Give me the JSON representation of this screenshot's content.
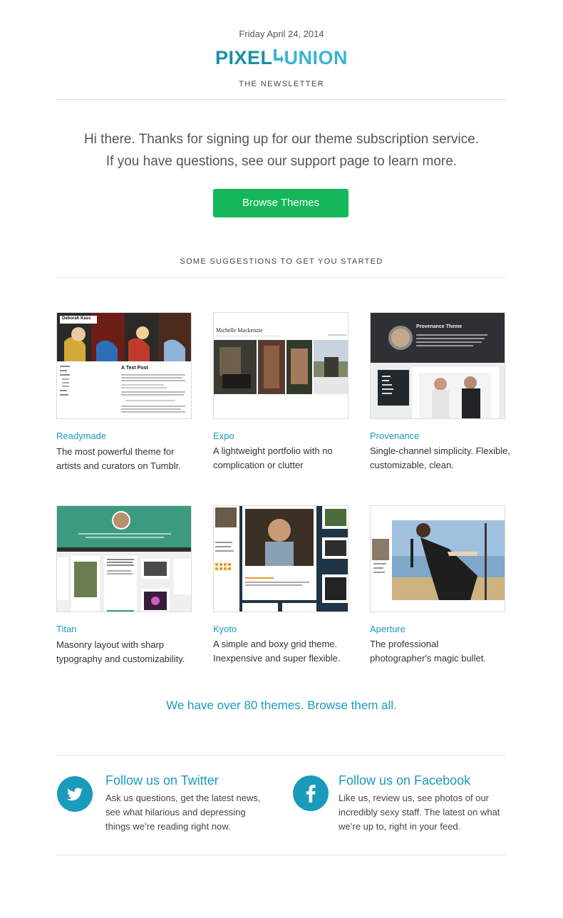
{
  "header": {
    "date": "Friday April 24, 2014",
    "logo_left": "PIXEL",
    "logo_right": "UNION",
    "subtitle": "THE NEWSLETTER"
  },
  "intro": {
    "line1": "Hi there. Thanks for signing up for our theme subscription service.",
    "line2": "If you have questions, see our support page to learn more."
  },
  "cta": {
    "label": "Browse Themes"
  },
  "suggestions_heading": "SOME SUGGESTIONS TO GET YOU STARTED",
  "themes": [
    {
      "name": "Readymade",
      "desc": "The most powerful theme for artists and curators on Tumblr.",
      "thumb_title": "Deborah Kass",
      "thumb_post": "A Text Post"
    },
    {
      "name": "Expo",
      "desc": "A lightweight portfolio with no complication or clutter",
      "thumb_title": "Michelle Mackenzie"
    },
    {
      "name": "Provenance",
      "desc": "Single-channel simplicity. Flexible, customizable, clean.",
      "thumb_title": "Provenance Theme"
    },
    {
      "name": "Titan",
      "desc": "Masonry layout with sharp typography and customizability."
    },
    {
      "name": "Kyoto",
      "desc": "A simple and boxy grid theme. Inexpensive and super flexible."
    },
    {
      "name": "Aperture",
      "desc": "The professional photographer's magic bullet."
    }
  ],
  "all_themes_link": "We have over 80 themes. Browse them all.",
  "social": {
    "twitter": {
      "title": "Follow us on Twitter",
      "text": "Ask us questions, get the latest news, see what hilarious and depressing things we’re reading right now."
    },
    "facebook": {
      "title": "Follow us on Facebook",
      "text": "Like us, review us, see photos of our incredibly sexy staff. The latest on what we’re up to, right in your feed."
    }
  },
  "colors": {
    "accent": "#1a9bbc",
    "button": "#14b85a",
    "logo_dark": "#1a8fa6",
    "logo_light": "#3ab5cf"
  }
}
